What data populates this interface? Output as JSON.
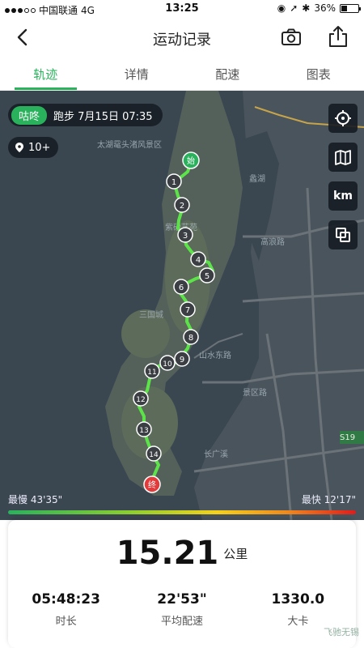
{
  "status": {
    "carrier": "中国联通",
    "network": "4G",
    "time": "13:25",
    "battery": "36%",
    "battery_level": 0.36
  },
  "nav": {
    "title": "运动记录"
  },
  "tabs": [
    {
      "label": "轨迹",
      "active": true
    },
    {
      "label": "详情",
      "active": false
    },
    {
      "label": "配速",
      "active": false
    },
    {
      "label": "图表",
      "active": false
    }
  ],
  "map": {
    "run_tag": "咕咚",
    "run_info": "跑步  7月15日  07:35",
    "poi_count": "10+",
    "controls": {
      "unit_label": "km"
    },
    "labels": {
      "scenic": "太湖鼋头渚风景区",
      "sanguo": "三国城",
      "art": "紫砂艺苑",
      "gaolang": "高浪路",
      "shanshui": "山水东路",
      "kaishan": "景区路",
      "s19": "S19",
      "changguang": "长广溪",
      "lihu": "蠡湖"
    },
    "start_label": "始",
    "end_label": "终",
    "markers": [
      "1",
      "2",
      "3",
      "4",
      "5",
      "6",
      "7",
      "8",
      "9",
      "10",
      "11",
      "12",
      "13",
      "14"
    ]
  },
  "pace": {
    "slowest_label": "最慢 43'35\"",
    "fastest_label": "最快 12'17\""
  },
  "summary": {
    "distance_value": "15.21",
    "distance_unit": "公里",
    "stats": [
      {
        "value": "05:48:23",
        "label": "时长"
      },
      {
        "value": "22'53\"",
        "label": "平均配速"
      },
      {
        "value": "1330.0",
        "label": "大卡"
      }
    ]
  },
  "watermark": "飞驰无锡"
}
